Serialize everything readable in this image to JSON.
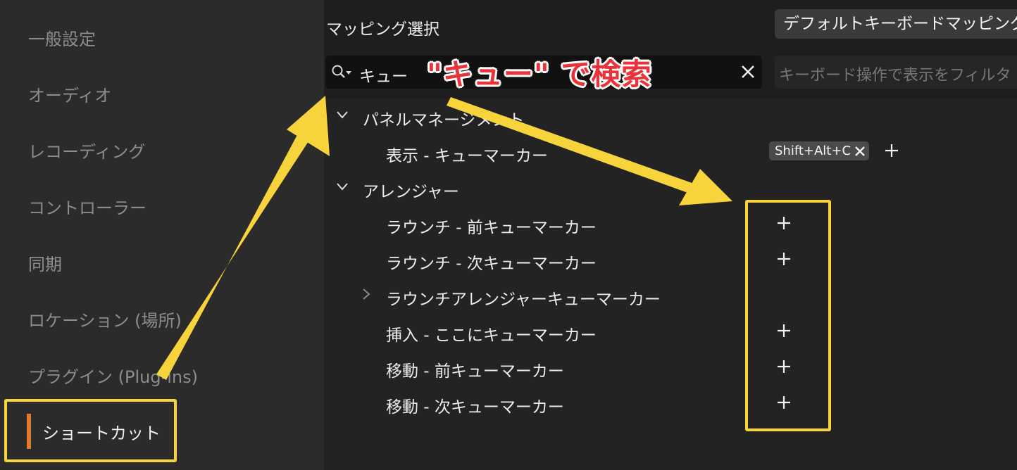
{
  "sidebar": {
    "items": [
      {
        "label": "一般設定"
      },
      {
        "label": "オーディオ"
      },
      {
        "label": "レコーディング"
      },
      {
        "label": "コントローラー"
      },
      {
        "label": "同期"
      },
      {
        "label": "ロケーション (場所)"
      },
      {
        "label": "プラグイン (Plug-ins)"
      },
      {
        "label": "ショートカット",
        "active": true
      }
    ]
  },
  "mapping": {
    "label": "マッピング選択",
    "selected": "デフォルトキーボードマッピング"
  },
  "search": {
    "value": "キュー",
    "filter_placeholder": "キーボード操作で表示をフィルタ"
  },
  "list": {
    "groups": [
      {
        "name": "パネルマネージメント",
        "items": [
          {
            "label": "表示 - キューマーカー",
            "shortcut": "Shift+Alt+C"
          }
        ]
      },
      {
        "name": "アレンジャー",
        "items": [
          {
            "label": "ラウンチ - 前キューマーカー"
          },
          {
            "label": "ラウンチ - 次キューマーカー"
          },
          {
            "label": "ラウンチアレンジャーキューマーカー"
          },
          {
            "label": "挿入 - ここにキューマーカー"
          },
          {
            "label": "移動 - 前キューマーカー"
          },
          {
            "label": "移動 - 次キューマーカー"
          }
        ]
      }
    ]
  },
  "annotation": {
    "caption": "\"キュー\" で検索",
    "color": "#f7d33c",
    "caption_color": "#e8333a"
  },
  "colors": {
    "accent": "#e07b2e",
    "sidebar_bg": "#2b2b2b",
    "main_bg": "#1e1e1e"
  }
}
